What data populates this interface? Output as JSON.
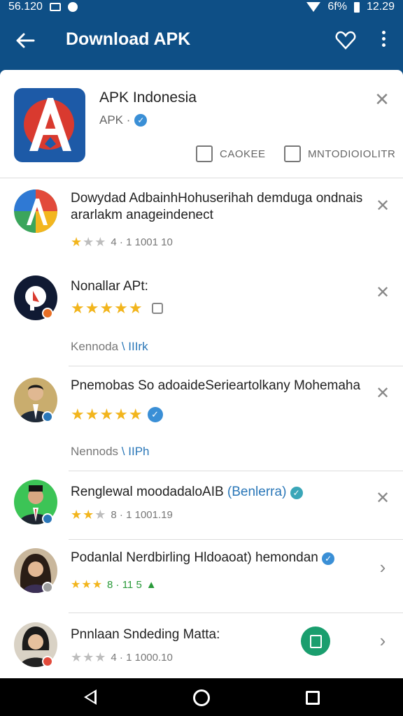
{
  "status_bar": {
    "time_left": "56.120",
    "battery": "6f%",
    "time_right": "12.29"
  },
  "app_bar": {
    "title": "Download APK"
  },
  "hero": {
    "name": "APK Indonesia",
    "developer": "APK ·",
    "share_label": "CAOKEE",
    "review_label": "MNTODIOIOLITR"
  },
  "rows": [
    {
      "title": "Dowydad AdbainhHohuserihah demduga ondnais ararlakm anageindenect",
      "meta": "4 · 1 1001 10",
      "rating": 1
    },
    {
      "title": "Nonallar APt:",
      "sub_label": "Kennoda",
      "sub_tag": "\\ IIIrk",
      "rating": 5
    },
    {
      "title": "Pnemobas So adoaideSerieartolkany Mohemaha",
      "sub_label": "Nennods",
      "sub_tag": "\\ IIPh",
      "rating": 5
    },
    {
      "title_main": "Renglewal moodadaloAIB",
      "title_accent": "(Benlerra)",
      "meta": "8 · 1 1001.19",
      "rating": 2
    },
    {
      "title": "Podanlal Nerdbirling Hldoaoat) hemondan",
      "meta": "8 · 11 5",
      "rating": 3
    },
    {
      "title": "Pnnlaan Sndeding Matta:",
      "meta": "4 · 1 1000.10",
      "rating": 0
    }
  ],
  "colors": {
    "primary": "#0e4f86",
    "accent": "#2a77b8",
    "star": "#f2b51d",
    "fab": "#1a9e6e"
  }
}
